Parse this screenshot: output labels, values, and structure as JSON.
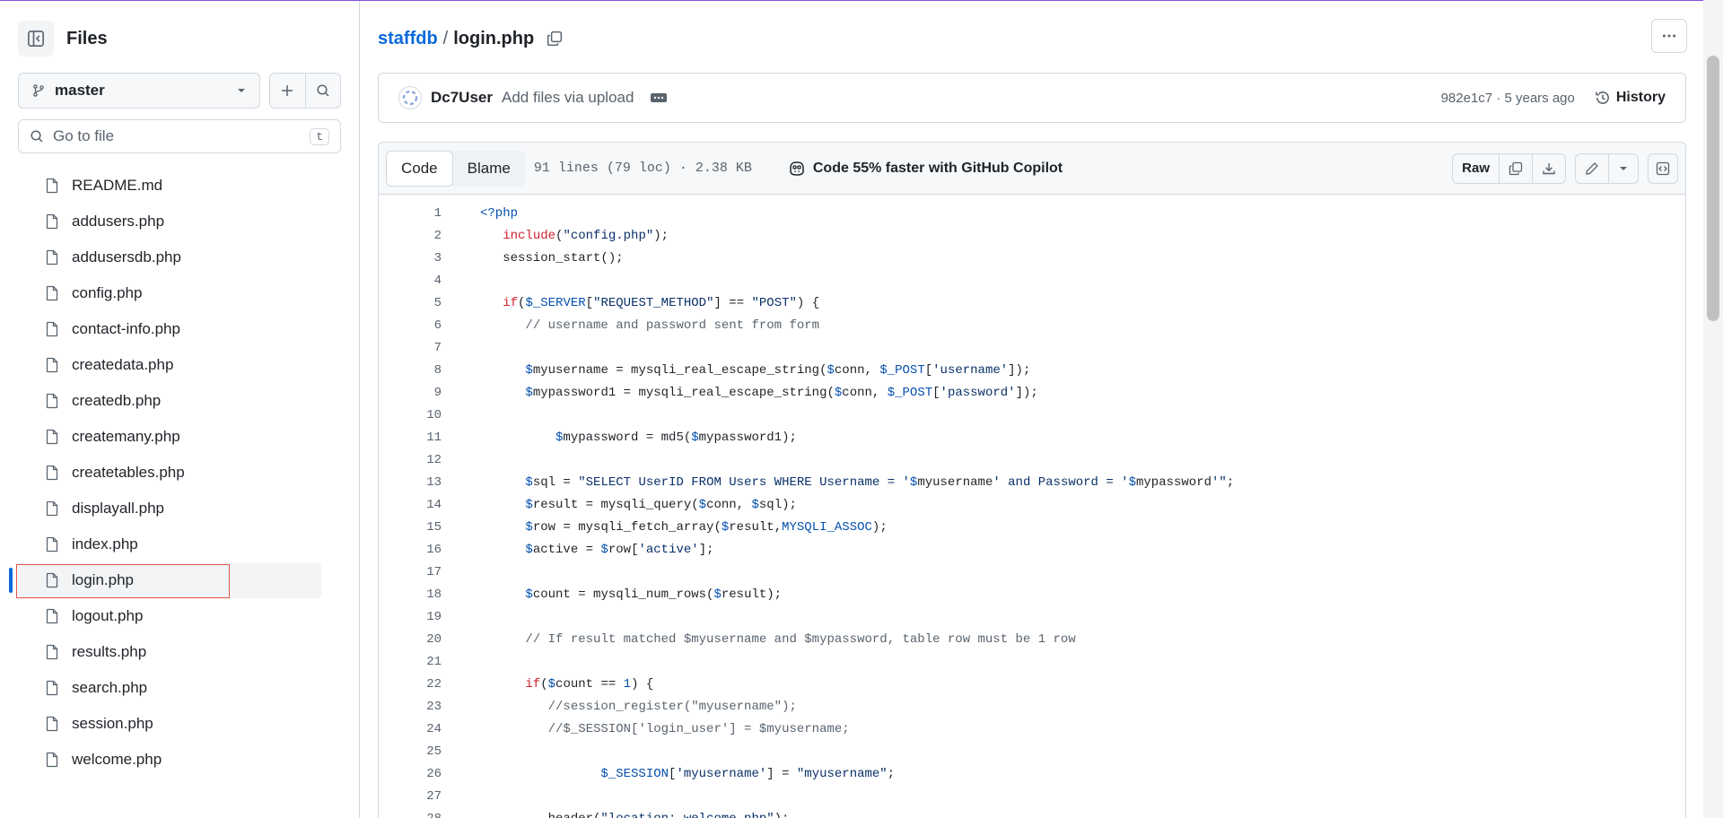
{
  "sidebar": {
    "title": "Files",
    "branch": "master",
    "goto_placeholder": "Go to file",
    "goto_shortcut": "t",
    "files": [
      {
        "name": "README.md",
        "active": false
      },
      {
        "name": "addusers.php",
        "active": false
      },
      {
        "name": "addusersdb.php",
        "active": false
      },
      {
        "name": "config.php",
        "active": false
      },
      {
        "name": "contact-info.php",
        "active": false
      },
      {
        "name": "createdata.php",
        "active": false
      },
      {
        "name": "createdb.php",
        "active": false
      },
      {
        "name": "createmany.php",
        "active": false
      },
      {
        "name": "createtables.php",
        "active": false
      },
      {
        "name": "displayall.php",
        "active": false
      },
      {
        "name": "index.php",
        "active": false
      },
      {
        "name": "login.php",
        "active": true
      },
      {
        "name": "logout.php",
        "active": false
      },
      {
        "name": "results.php",
        "active": false
      },
      {
        "name": "search.php",
        "active": false
      },
      {
        "name": "session.php",
        "active": false
      },
      {
        "name": "welcome.php",
        "active": false
      }
    ]
  },
  "breadcrumb": {
    "repo": "staffdb",
    "separator": "/",
    "file": "login.php"
  },
  "commit": {
    "author": "Dc7User",
    "message": "Add files via upload",
    "meta": "982e1c7 · 5 years ago",
    "history_label": "History"
  },
  "code_header": {
    "tab_code": "Code",
    "tab_blame": "Blame",
    "stats": "91 lines (79 loc) · 2.38 KB",
    "copilot": "Code 55% faster with GitHub Copilot",
    "raw_label": "Raw"
  },
  "code_lines": [
    {
      "n": "1",
      "html": "<span class=\"v\">&lt;?php</span>"
    },
    {
      "n": "2",
      "html": "   <span class=\"k\">include</span>(<span class=\"s\">\"config.php\"</span>);"
    },
    {
      "n": "3",
      "html": "   session_start();"
    },
    {
      "n": "4",
      "html": ""
    },
    {
      "n": "5",
      "html": "   <span class=\"k\">if</span>(<span class=\"v\">$_SERVER</span>[<span class=\"s\">\"REQUEST_METHOD\"</span>] == <span class=\"s\">\"POST\"</span>) {"
    },
    {
      "n": "6",
      "html": "      <span class=\"c\">// username and password sent from form</span>"
    },
    {
      "n": "7",
      "html": ""
    },
    {
      "n": "8",
      "html": "      <span class=\"v\">$</span>myusername = mysqli_real_escape_string(<span class=\"v\">$</span>conn, <span class=\"v\">$_POST</span>[<span class=\"s\">'username'</span>]);"
    },
    {
      "n": "9",
      "html": "      <span class=\"v\">$</span>mypassword1 = mysqli_real_escape_string(<span class=\"v\">$</span>conn, <span class=\"v\">$_POST</span>[<span class=\"s\">'password'</span>]);"
    },
    {
      "n": "10",
      "html": ""
    },
    {
      "n": "11",
      "html": "          <span class=\"v\">$</span>mypassword = md5(<span class=\"v\">$</span>mypassword1);"
    },
    {
      "n": "12",
      "html": ""
    },
    {
      "n": "13",
      "html": "      <span class=\"v\">$</span>sql = <span class=\"s\">\"SELECT UserID FROM Users WHERE Username = '</span><span class=\"v\">$</span>myusername<span class=\"s\">' and Password = '</span><span class=\"v\">$</span>mypassword<span class=\"s\">'\"</span>;"
    },
    {
      "n": "14",
      "html": "      <span class=\"v\">$</span>result = mysqli_query(<span class=\"v\">$</span>conn, <span class=\"v\">$</span>sql);"
    },
    {
      "n": "15",
      "html": "      <span class=\"v\">$</span>row = mysqli_fetch_array(<span class=\"v\">$</span>result,<span class=\"v\">MYSQLI_ASSOC</span>);"
    },
    {
      "n": "16",
      "html": "      <span class=\"v\">$</span>active = <span class=\"v\">$</span>row[<span class=\"s\">'active'</span>];"
    },
    {
      "n": "17",
      "html": ""
    },
    {
      "n": "18",
      "html": "      <span class=\"v\">$</span>count = mysqli_num_rows(<span class=\"v\">$</span>result);"
    },
    {
      "n": "19",
      "html": ""
    },
    {
      "n": "20",
      "html": "      <span class=\"c\">// If result matched $myusername and $mypassword, table row must be 1 row</span>"
    },
    {
      "n": "21",
      "html": ""
    },
    {
      "n": "22",
      "html": "      <span class=\"k\">if</span>(<span class=\"v\">$</span>count == <span class=\"v\">1</span>) {"
    },
    {
      "n": "23",
      "html": "         <span class=\"c\">//session_register(\"myusername\");</span>"
    },
    {
      "n": "24",
      "html": "         <span class=\"c\">//$_SESSION['login_user'] = $myusername;</span>"
    },
    {
      "n": "25",
      "html": ""
    },
    {
      "n": "26",
      "html": "                <span class=\"v\">$_SESSION</span>[<span class=\"s\">'myusername'</span>] = <span class=\"s\">\"myusername\"</span>;"
    },
    {
      "n": "27",
      "html": ""
    },
    {
      "n": "28",
      "html": "         header(<span class=\"s\">\"location: welcome.php\"</span>);"
    }
  ]
}
